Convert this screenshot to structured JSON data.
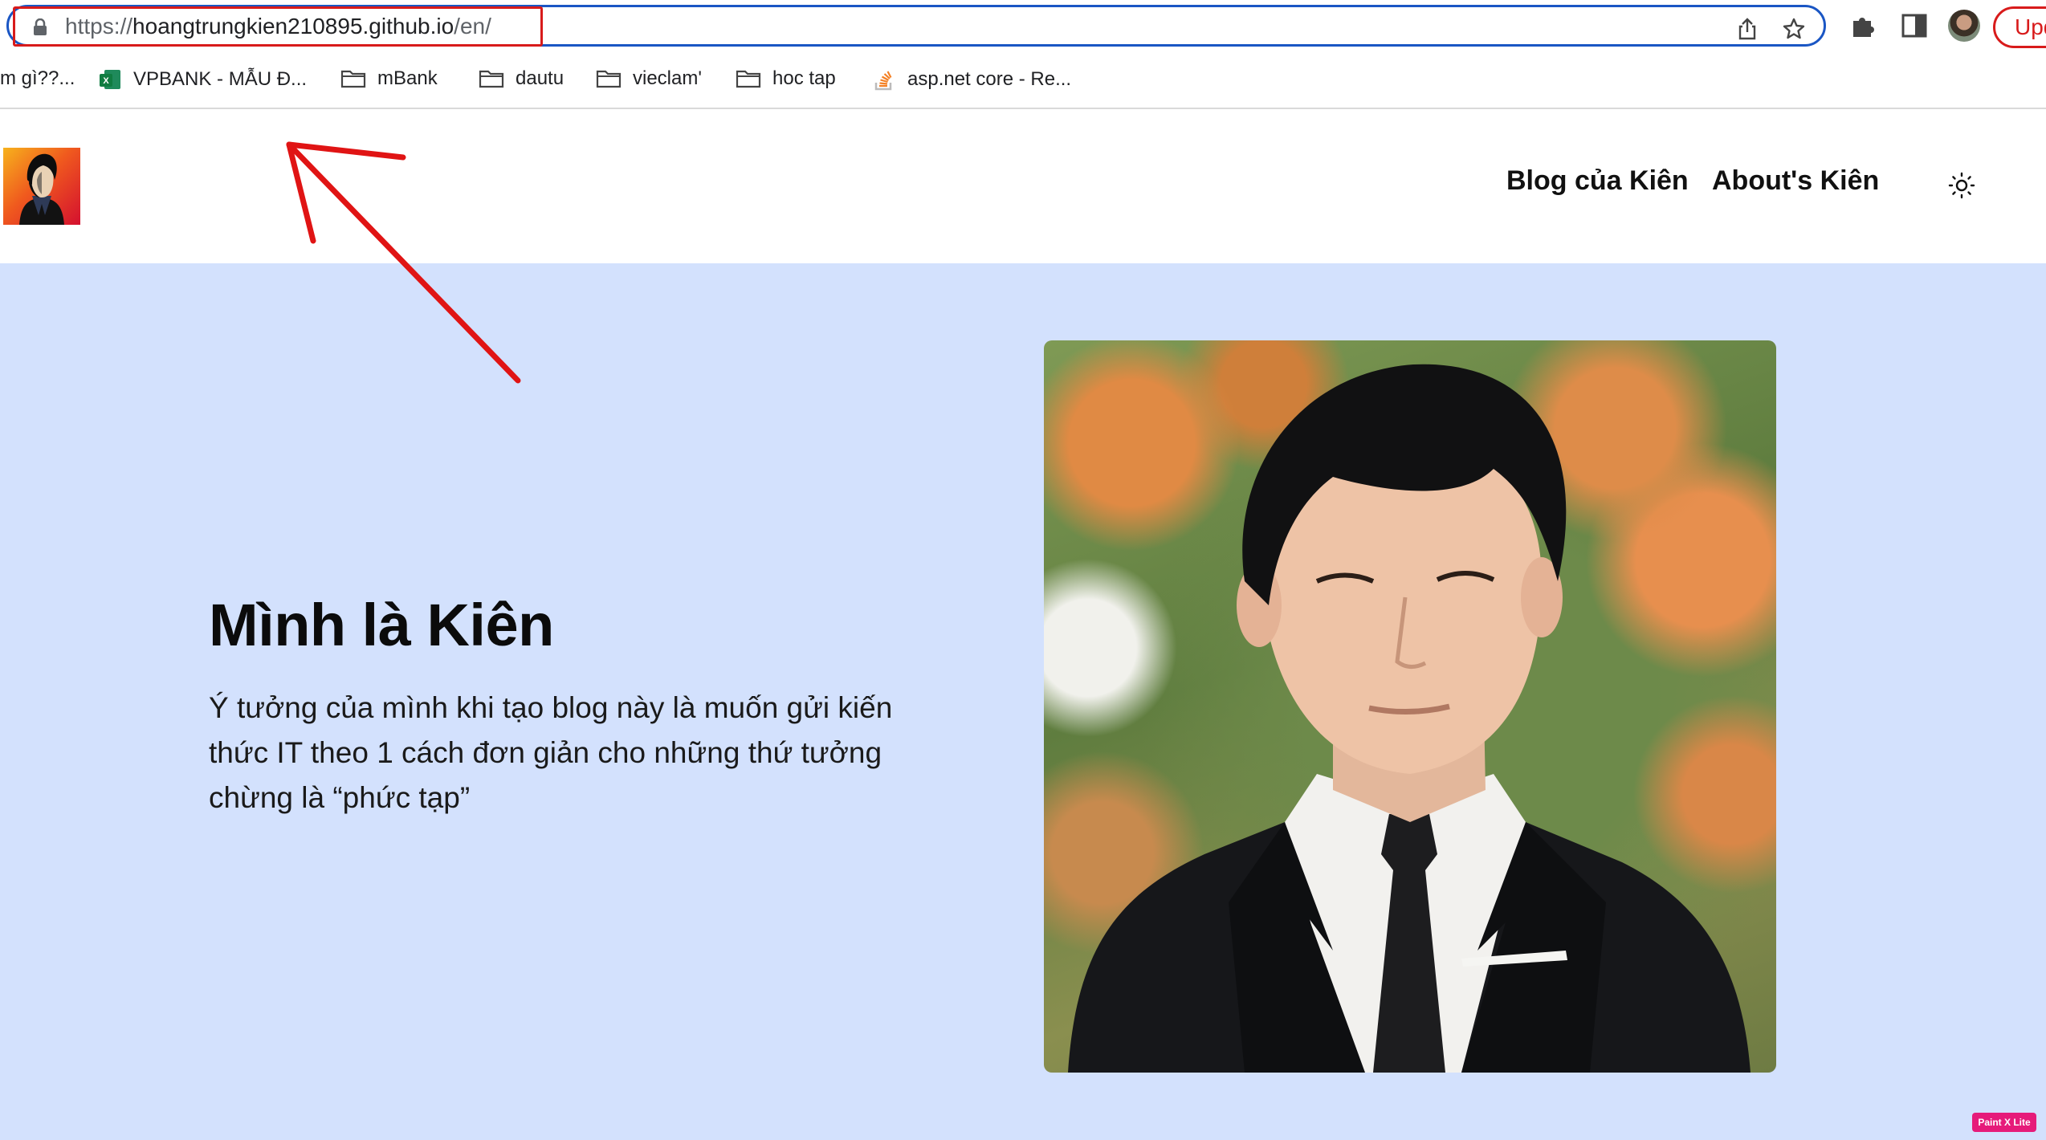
{
  "browser": {
    "url": {
      "scheme": "https://",
      "host": "hoangtrungkien210895.github.io",
      "path": "/en/"
    },
    "update_label": "Upd",
    "bookmarks": [
      {
        "label": "m gì??...",
        "icon": "none"
      },
      {
        "label": "VPBANK - MẪU Đ...",
        "icon": "excel-icon"
      },
      {
        "label": "mBank",
        "icon": "folder-icon"
      },
      {
        "label": "dautu",
        "icon": "folder-icon"
      },
      {
        "label": "vieclam'",
        "icon": "folder-icon"
      },
      {
        "label": "hoc tap",
        "icon": "folder-icon"
      },
      {
        "label": "asp.net core - Re...",
        "icon": "stackoverflow-icon"
      }
    ]
  },
  "site": {
    "nav": [
      {
        "label": "Blog của Kiên"
      },
      {
        "label": "About's Kiên"
      }
    ],
    "theme_toggle_icon": "sun-icon"
  },
  "hero": {
    "title": "Mình là Kiên",
    "description": "Ý tưởng của mình khi tạo blog này là muốn gửi kiến thức IT theo 1 cách đơn giản cho những thứ tưởng chừng là “phức tạp”"
  },
  "overlay": {
    "badge": "Paint X Lite"
  },
  "colors": {
    "omnibox_border": "#1a56c4",
    "highlight_red": "#d81b1b",
    "hero_bg": "#d3e1fd",
    "logo_gradient": [
      "#f7b21d",
      "#f05a1e",
      "#d4102f"
    ]
  }
}
